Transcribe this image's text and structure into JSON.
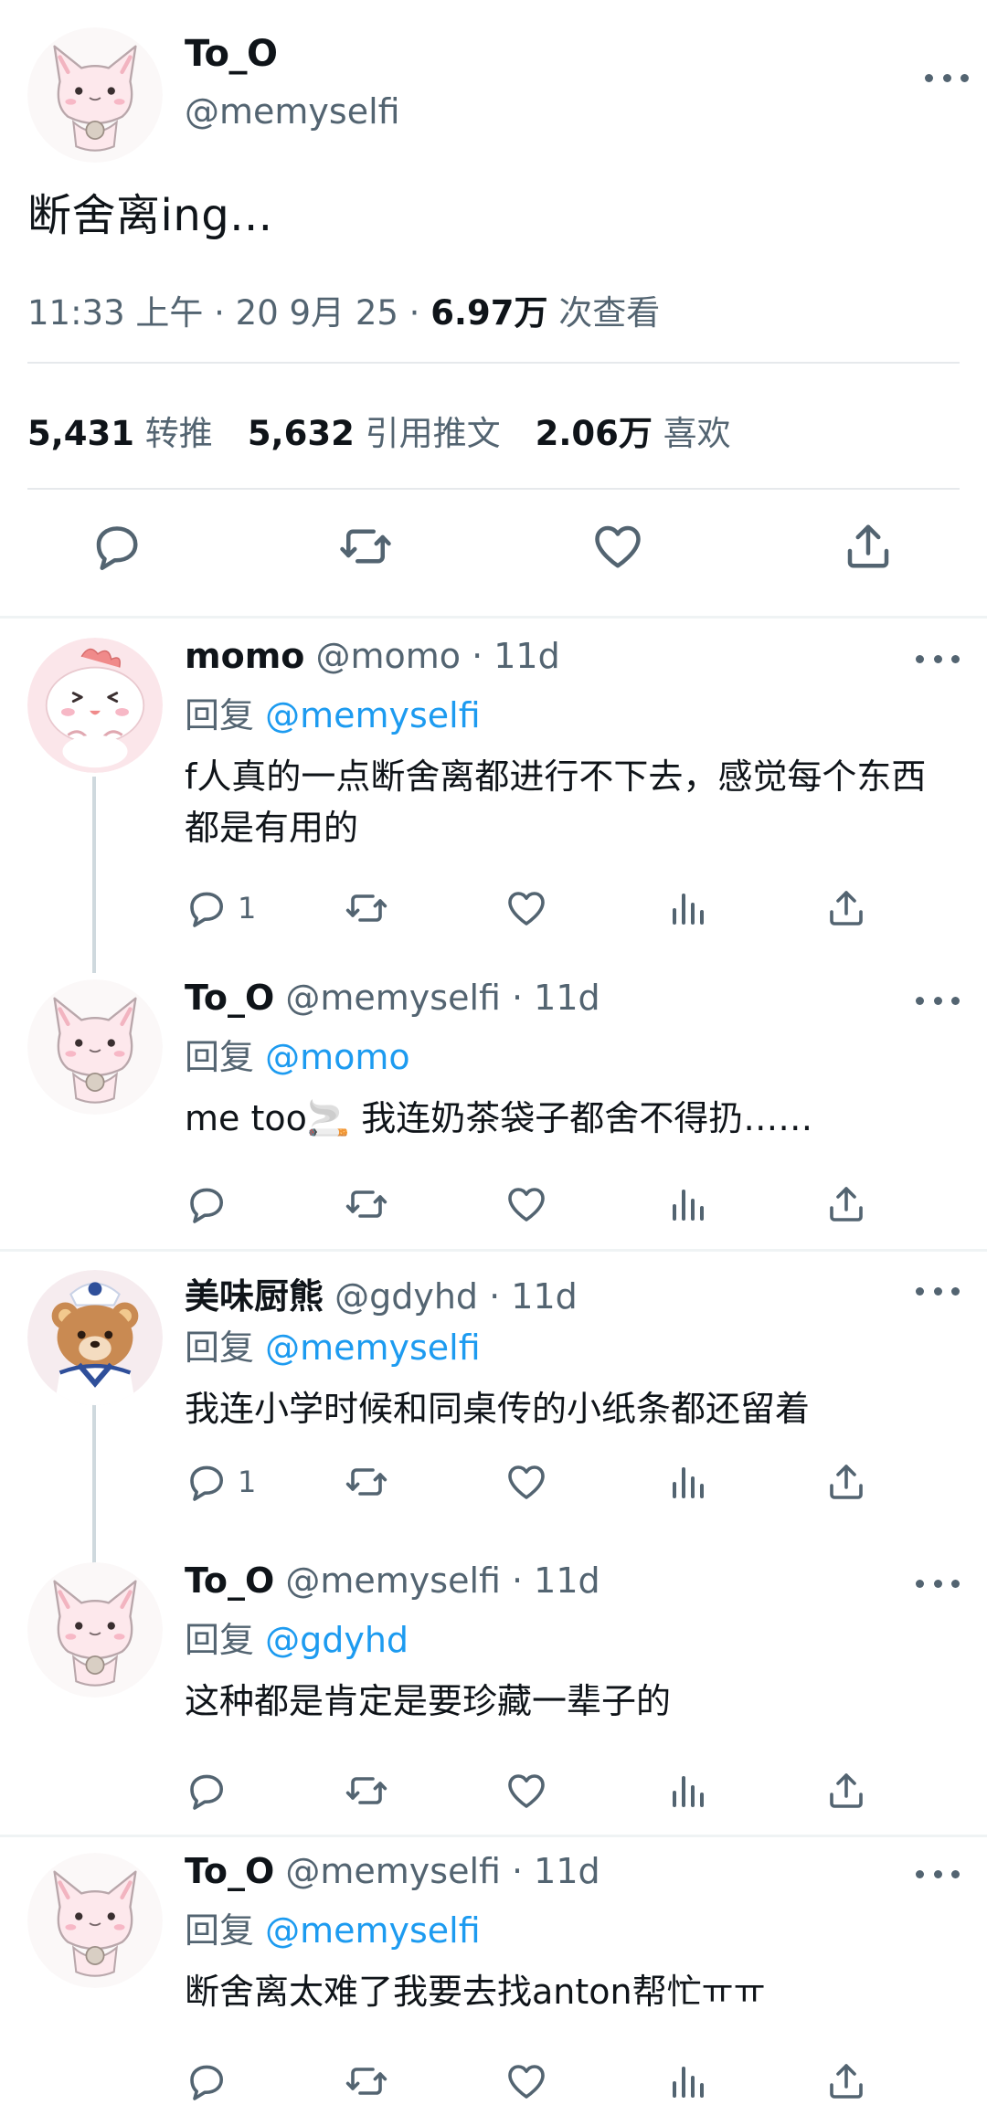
{
  "main_tweet": {
    "name": "To_O",
    "handle": "@memyselfi",
    "text": "断舍离ing...",
    "time": "11:33 上午 · 20 9月 25 · ",
    "views_value": "6.97万",
    "views_label": " 次查看",
    "retweets_value": "5,431",
    "retweets_label": " 转推",
    "quotes_value": "5,632",
    "quotes_label": " 引用推文",
    "likes_value": "2.06万",
    "likes_label": " 喜欢"
  },
  "reply_prefix": "回复 ",
  "replies": [
    {
      "name": "momo",
      "handle": " @momo · 11d",
      "reply_to": "@memyselfi",
      "text": "f人真的一点断舍离都进行不下去，感觉每个东西都是有用的",
      "reply_count": "1"
    },
    {
      "name": "To_O",
      "handle": " @memyselfi · 11d",
      "reply_to": "@momo",
      "text": "me too🚬 我连奶茶袋子都舍不得扔……",
      "reply_count": ""
    },
    {
      "name": "美味厨熊",
      "handle": " @gdyhd · 11d",
      "reply_to": "@memyselfi",
      "text": "我连小学时候和同桌传的小纸条都还留着",
      "reply_count": "1"
    },
    {
      "name": "To_O",
      "handle": " @memyselfi · 11d",
      "reply_to": "@gdyhd",
      "text": "这种都是肯定是要珍藏一辈子的",
      "reply_count": ""
    },
    {
      "name": "To_O",
      "handle": " @memyselfi · 11d",
      "reply_to": "@memyselfi",
      "text": "断舍离太难了我要去找anton帮忙ㅠㅠ",
      "reply_count": ""
    }
  ],
  "colors": {
    "text": "#0f1419",
    "secondary": "#536471",
    "link": "#1d9bf0",
    "divider": "#e6e9ec"
  },
  "icons": [
    "more-icon",
    "reply-icon",
    "retweet-icon",
    "like-icon",
    "views-icon",
    "share-icon",
    "cat-avatar",
    "bunny-avatar",
    "bear-avatar"
  ]
}
